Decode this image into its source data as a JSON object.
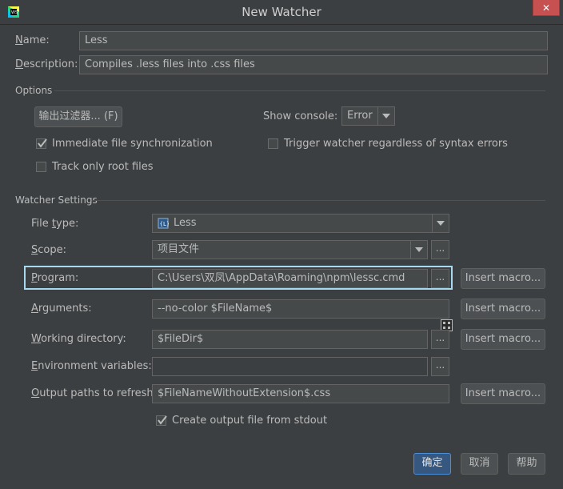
{
  "window": {
    "title": "New Watcher",
    "close_label": "✕"
  },
  "name": {
    "label_pre": "",
    "label_u": "N",
    "label_post": "ame:",
    "value": "Less"
  },
  "description": {
    "label_pre": "",
    "label_u": "D",
    "label_post": "escription:",
    "value": "Compiles .less files into .css files"
  },
  "options": {
    "section_label": "Options",
    "filter_button": "输出过滤器... (F)",
    "show_console_label": "Show console:",
    "show_console_value": "Error",
    "immediate_sync": {
      "label": "Immediate file synchronization",
      "checked": true
    },
    "trigger_watcher": {
      "label": "Trigger watcher regardless of syntax errors",
      "checked": false
    },
    "track_root": {
      "label": "Track only root files",
      "checked": false
    }
  },
  "watcher_settings": {
    "section_label": "Watcher Settings",
    "file_type": {
      "label_pre": "File ",
      "label_u": "t",
      "label_post": "ype:",
      "value": "Less",
      "icon": "less-file-icon"
    },
    "scope": {
      "label_pre": "",
      "label_u": "S",
      "label_post": "cope:",
      "value": "项目文件"
    },
    "program": {
      "label_pre": "",
      "label_u": "P",
      "label_post": "rogram:",
      "value": "C:\\Users\\双凤\\AppData\\Roaming\\npm\\lessc.cmd"
    },
    "arguments": {
      "label_pre": "",
      "label_u": "A",
      "label_post": "rguments:",
      "value": "--no-color $FileName$"
    },
    "working_dir": {
      "label_pre": "",
      "label_u": "W",
      "label_post": "orking directory:",
      "value": "$FileDir$"
    },
    "env_vars": {
      "label_pre": "",
      "label_u": "E",
      "label_post": "nvironment variables:",
      "value": ""
    },
    "output_paths": {
      "label_pre": "",
      "label_u": "O",
      "label_post": "utput paths to refresh:",
      "value": "$FileNameWithoutExtension$.css"
    },
    "create_output": {
      "label": "Create output file from stdout",
      "checked": true
    },
    "insert_macro_label": "Insert macro...",
    "ellipsis": "..."
  },
  "footer": {
    "ok": "确定",
    "cancel": "取消",
    "help": "帮助"
  },
  "colors": {
    "background": "#3c3f41",
    "field": "#45494a",
    "accent": "#4a90d9",
    "highlight": "#a7daf0",
    "close": "#c75050"
  }
}
